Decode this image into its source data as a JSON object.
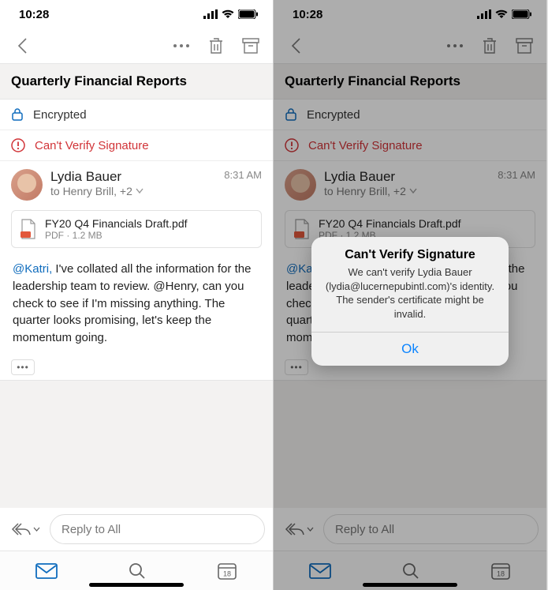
{
  "status": {
    "time": "10:28"
  },
  "subject": "Quarterly Financial Reports",
  "encrypted_label": "Encrypted",
  "warning_label": "Can't Verify Signature",
  "sender": {
    "name": "Lydia Bauer",
    "to_line": "to Henry Brill, +2",
    "time": "8:31 AM"
  },
  "attachment": {
    "name": "FY20 Q4 Financials Draft.pdf",
    "meta": "PDF · 1.2 MB"
  },
  "body": {
    "mention1": "@Katri,",
    "text": " I've collated all the information for the leadership team to review. @Henry, can you check to see if I'm missing anything. The quarter looks promising, let's keep the momentum going."
  },
  "reply_placeholder": "Reply to All",
  "calendar_day": "18",
  "alert": {
    "title": "Can't Verify Signature",
    "message": "We can't verify Lydia Bauer (lydia@lucernepubintl.com)'s identity. The sender's certificate might be invalid.",
    "ok": "Ok"
  }
}
